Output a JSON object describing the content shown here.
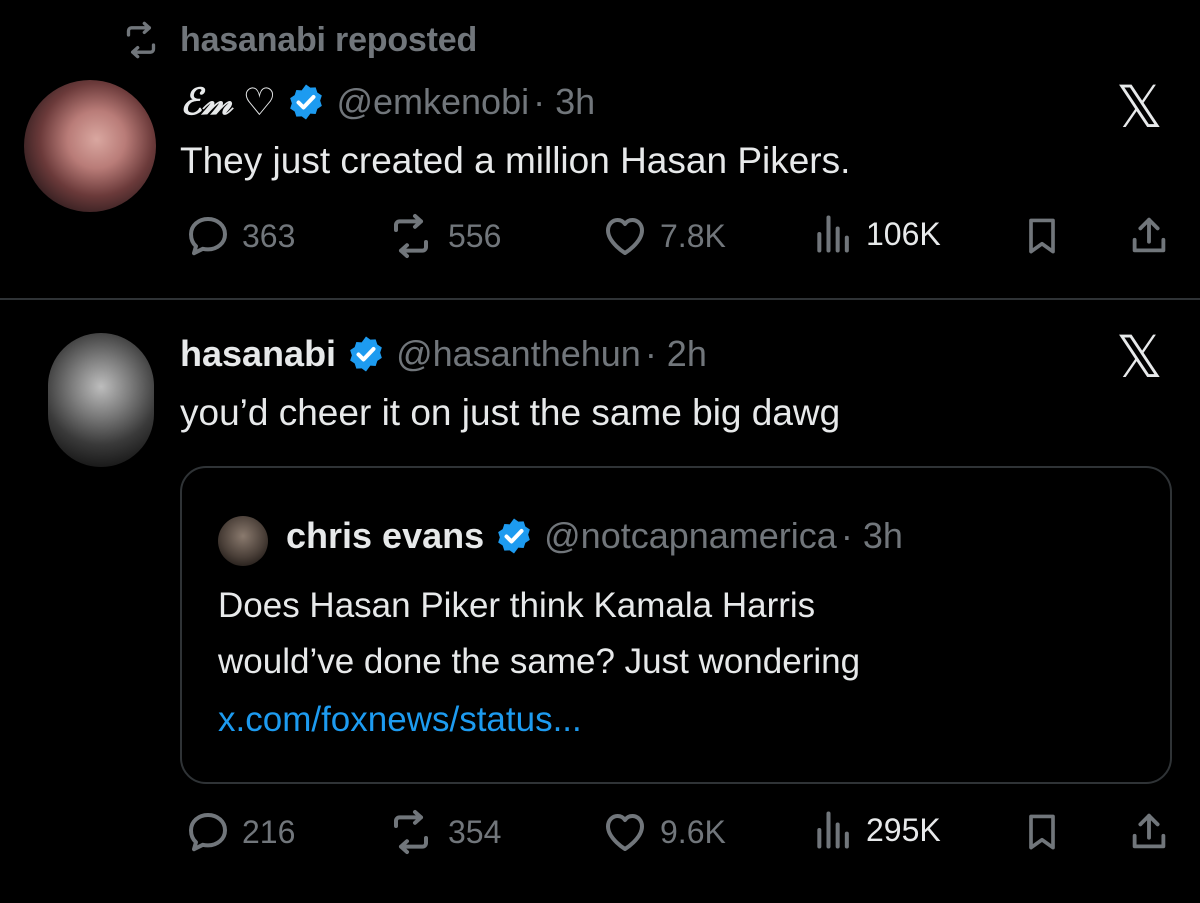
{
  "repost": {
    "label": "hasanabi reposted",
    "icon": "repost-icon"
  },
  "tweet1": {
    "display_name": "ℰ𝓂",
    "heart": "♡",
    "handle": "@emkenobi",
    "time": "· 3h",
    "text": "They just created a million Hasan Pikers.",
    "stats": {
      "replies": "363",
      "reposts": "556",
      "likes": "7.8K",
      "views": "106K"
    }
  },
  "tweet2": {
    "display_name": "hasanabi",
    "handle": "@hasanthehun",
    "time": "· 2h",
    "text": "you’d cheer it on just the same big dawg",
    "quote": {
      "display_name": "chris evans",
      "handle": "@notcapnamerica",
      "time": "· 3h",
      "line1": "Does Hasan Piker think Kamala Harris",
      "line2": "would’ve done the same? Just wondering",
      "link": "x.com/foxnews/status..."
    },
    "stats": {
      "replies": "216",
      "reposts": "354",
      "likes": "9.6K",
      "views": "295K"
    }
  },
  "x_logo": "𝕏",
  "colors": {
    "background": "#000000",
    "text": "#e7e9ea",
    "muted": "#71767b",
    "verified": "#1d9bf0",
    "link": "#1d9bf0",
    "border": "#2f3336"
  }
}
